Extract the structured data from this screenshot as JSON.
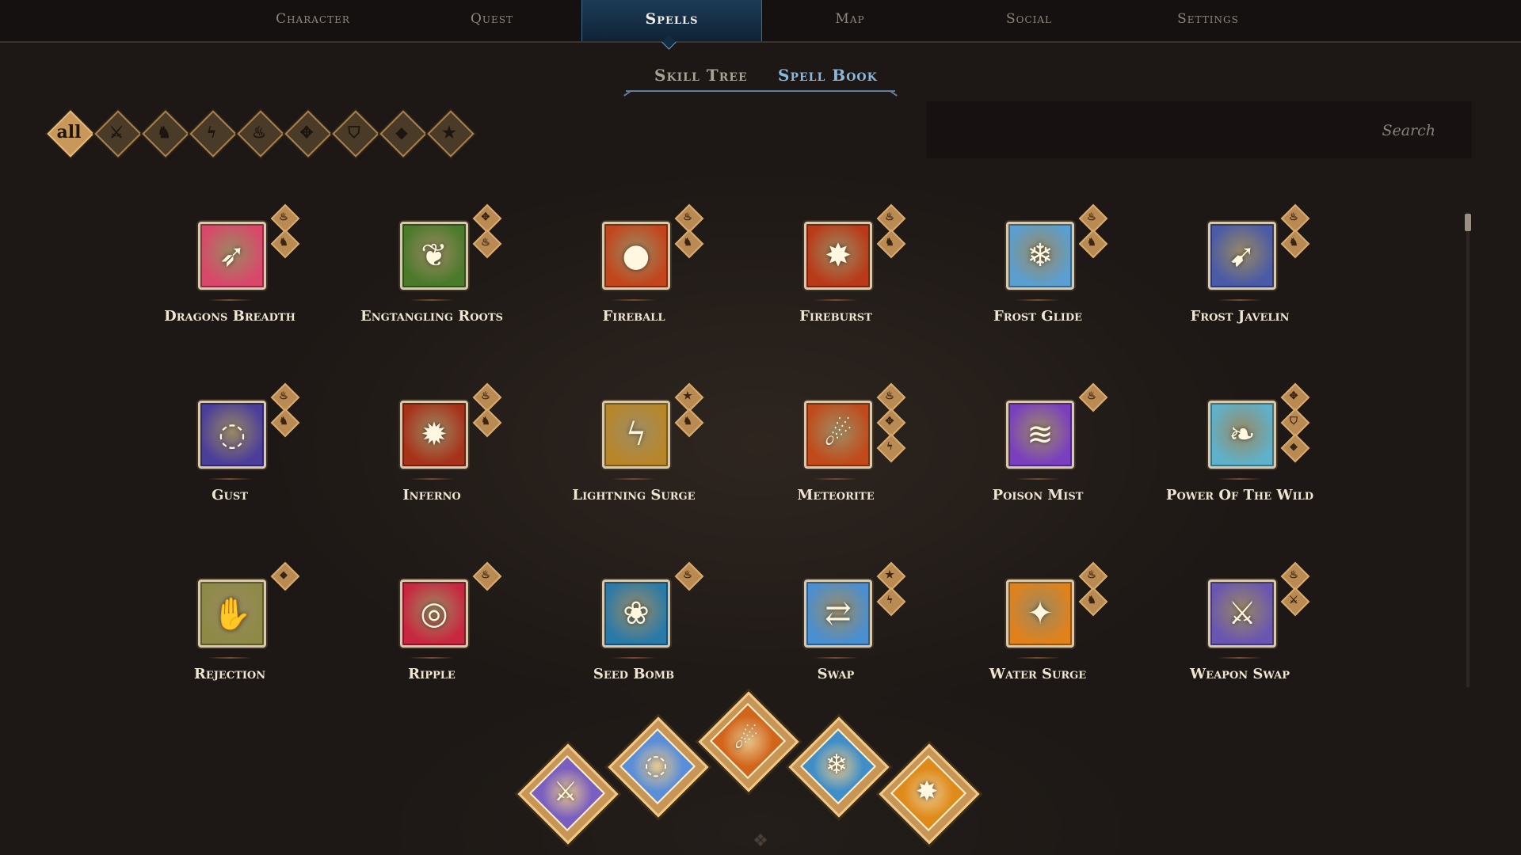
{
  "nav": {
    "tabs": [
      {
        "label": "Character"
      },
      {
        "label": "Quest"
      },
      {
        "label": "Spells"
      },
      {
        "label": "Map"
      },
      {
        "label": "Social"
      },
      {
        "label": "Settings"
      }
    ],
    "active": "Spells"
  },
  "subtabs": {
    "skill_tree": "Skill Tree",
    "spell_book": "Spell Book",
    "active": "Spell Book"
  },
  "filters": [
    {
      "icon": "all-filter-icon",
      "glyph": "all",
      "active": true
    },
    {
      "icon": "sword-icon",
      "glyph": "⚔",
      "active": false
    },
    {
      "icon": "helmet-icon",
      "glyph": "♞",
      "active": false
    },
    {
      "icon": "lightning-icon",
      "glyph": "ϟ",
      "active": false
    },
    {
      "icon": "fire-icon",
      "glyph": "♨",
      "active": false
    },
    {
      "icon": "compass-icon",
      "glyph": "✥",
      "active": false
    },
    {
      "icon": "shield-icon",
      "glyph": "⛉",
      "active": false
    },
    {
      "icon": "gem-icon",
      "glyph": "◆",
      "active": false
    },
    {
      "icon": "star-icon",
      "glyph": "★",
      "active": false
    }
  ],
  "search": {
    "placeholder": "Search"
  },
  "spells": [
    {
      "name": "Dragons Breadth",
      "glyph": "➶",
      "bg": "#d9486a",
      "badges": [
        "♨",
        "♞"
      ]
    },
    {
      "name": "Engtangling Roots",
      "glyph": "❦",
      "bg": "#4a7a2a",
      "badges": [
        "✥",
        "♨"
      ]
    },
    {
      "name": "Fireball",
      "glyph": "●",
      "bg": "#c2461c",
      "badges": [
        "♨",
        "♞"
      ]
    },
    {
      "name": "Fireburst",
      "glyph": "✸",
      "bg": "#b93a18",
      "badges": [
        "♨",
        "♞"
      ]
    },
    {
      "name": "Frost Glide",
      "glyph": "❄",
      "bg": "#5a9fcf",
      "badges": [
        "♨",
        "♞"
      ]
    },
    {
      "name": "Frost Javelin",
      "glyph": "➹",
      "bg": "#4a5aa6",
      "badges": [
        "♨",
        "♞"
      ]
    },
    {
      "name": "Gust",
      "glyph": "◌",
      "bg": "#4b3d9a",
      "badges": [
        "♨",
        "♞"
      ]
    },
    {
      "name": "Inferno",
      "glyph": "✹",
      "bg": "#a7321a",
      "badges": [
        "♨",
        "♞"
      ]
    },
    {
      "name": "Lightning Surge",
      "glyph": "ϟ",
      "bg": "#b8862a",
      "badges": [
        "★",
        "♞"
      ]
    },
    {
      "name": "Meteorite",
      "glyph": "☄",
      "bg": "#c04a1a",
      "badges": [
        "♨",
        "✥",
        "ϟ"
      ]
    },
    {
      "name": "Poison Mist",
      "glyph": "≋",
      "bg": "#7a3fbf",
      "badges": [
        "♨"
      ]
    },
    {
      "name": "Power Of The Wild",
      "glyph": "❧",
      "bg": "#5fb1c9",
      "badges": [
        "✥",
        "⛉",
        "◆"
      ]
    },
    {
      "name": "Rejection",
      "glyph": "✋",
      "bg": "#8e8a46",
      "badges": [
        "◆"
      ]
    },
    {
      "name": "Ripple",
      "glyph": "◎",
      "bg": "#c8283f",
      "badges": [
        "♨"
      ]
    },
    {
      "name": "Seed Bomb",
      "glyph": "❀",
      "bg": "#2a7aa8",
      "badges": [
        "♨"
      ]
    },
    {
      "name": "Swap",
      "glyph": "⇄",
      "bg": "#4a8fd0",
      "badges": [
        "★",
        "ϟ"
      ]
    },
    {
      "name": "Water Surge",
      "glyph": "✦",
      "bg": "#e0821c",
      "badges": [
        "♨",
        "♞"
      ]
    },
    {
      "name": "Weapon Swap",
      "glyph": "⚔",
      "bg": "#6a56b0",
      "badges": [
        "♨",
        "⚔"
      ]
    }
  ],
  "hotbar": [
    {
      "spell": "Weapon Swap",
      "glyph": "⚔",
      "bg": "#7a5ec0"
    },
    {
      "spell": "Gust",
      "glyph": "◌",
      "bg": "#5b8ed8"
    },
    {
      "spell": "Meteorite",
      "glyph": "☄",
      "bg": "#d2651c"
    },
    {
      "spell": "Frost Glide",
      "glyph": "❄",
      "bg": "#3f8ec8"
    },
    {
      "spell": "Fireburst",
      "glyph": "✸",
      "bg": "#e08a1a"
    }
  ]
}
